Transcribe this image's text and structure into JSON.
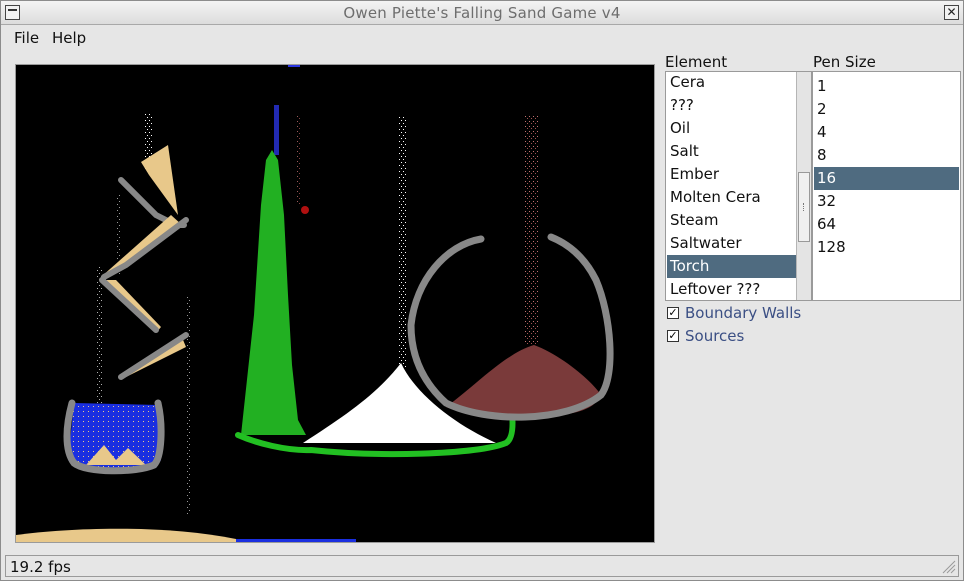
{
  "window": {
    "title": "Owen Piette's Falling Sand Game v4"
  },
  "menu": {
    "file": "File",
    "help": "Help"
  },
  "panel": {
    "element_label": "Element",
    "pen_label": "Pen Size"
  },
  "elements": {
    "items": [
      "Cera",
      "???",
      "Oil",
      "Salt",
      "Ember",
      "Molten Cera",
      "Steam",
      "Saltwater",
      "Torch",
      "Leftover ???"
    ],
    "selected": "Torch"
  },
  "pen_sizes": {
    "items": [
      "1",
      "2",
      "4",
      "8",
      "16",
      "32",
      "64",
      "128"
    ],
    "selected": "16"
  },
  "options": {
    "boundary_walls": "Boundary Walls",
    "boundary_walls_checked": true,
    "sources": "Sources",
    "sources_checked": true
  },
  "status": {
    "fps": "19.2 fps"
  },
  "colors": {
    "selection": "#4f6b80",
    "wall": "#888888",
    "sand": "#e8c88a",
    "water": "#1a2fe0",
    "plant": "#22b022",
    "salt": "#ffffff",
    "ember_pile": "#7a3a3a"
  }
}
